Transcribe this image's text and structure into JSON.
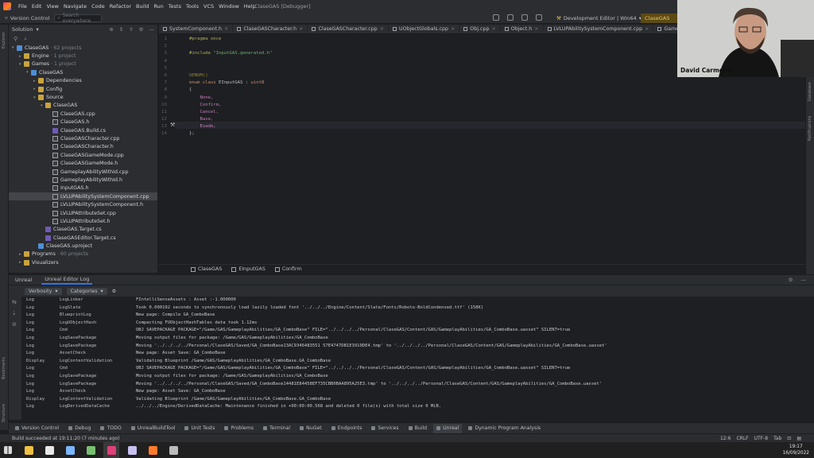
{
  "window": {
    "title": "ClaseGAS [Debugger]",
    "menu": [
      "File",
      "Edit",
      "View",
      "Navigate",
      "Code",
      "Refactor",
      "Build",
      "Run",
      "Tests",
      "Tools",
      "VCS",
      "Window",
      "Help"
    ]
  },
  "toolbar": {
    "version_control": "Version Control",
    "search_placeholder": "Search everywhere",
    "config": "Development Editor | Win64",
    "run_target": "ClaseGAS"
  },
  "explorer": {
    "mode": "Solution",
    "tree": [
      {
        "label": "ClaseGAS",
        "sub": "· 62 projects",
        "depth": 0,
        "arrow": "▾",
        "icon": "proj"
      },
      {
        "label": "Engine",
        "sub": "· 1 project",
        "depth": 1,
        "arrow": "▸",
        "icon": "folder"
      },
      {
        "label": "Games",
        "sub": "· 1 project",
        "depth": 1,
        "arrow": "▾",
        "icon": "folder"
      },
      {
        "label": "ClaseGAS",
        "sub": "",
        "depth": 2,
        "arrow": "▾",
        "icon": "proj"
      },
      {
        "label": "Dependencies",
        "sub": "",
        "depth": 3,
        "arrow": "▸",
        "icon": "folder"
      },
      {
        "label": "Config",
        "sub": "",
        "depth": 3,
        "arrow": "▸",
        "icon": "folder"
      },
      {
        "label": "Source",
        "sub": "",
        "depth": 3,
        "arrow": "▾",
        "icon": "folder"
      },
      {
        "label": "ClaseGAS",
        "sub": "",
        "depth": 4,
        "arrow": "▾",
        "icon": "folder"
      },
      {
        "label": "ClaseGAS.cpp",
        "sub": "",
        "depth": 5,
        "arrow": "",
        "icon": "file"
      },
      {
        "label": "ClaseGAS.h",
        "sub": "",
        "depth": 5,
        "arrow": "",
        "icon": "file"
      },
      {
        "label": "ClaseGAS.Build.cs",
        "sub": "",
        "depth": 5,
        "arrow": "",
        "icon": "cs"
      },
      {
        "label": "ClaseGASCharacter.cpp",
        "sub": "",
        "depth": 5,
        "arrow": "",
        "icon": "file"
      },
      {
        "label": "ClaseGASCharacter.h",
        "sub": "",
        "depth": 5,
        "arrow": "",
        "icon": "file"
      },
      {
        "label": "ClaseGASGameMode.cpp",
        "sub": "",
        "depth": 5,
        "arrow": "",
        "icon": "file"
      },
      {
        "label": "ClaseGASGameMode.h",
        "sub": "",
        "depth": 5,
        "arrow": "",
        "icon": "file"
      },
      {
        "label": "GameplayAbilityWithId.cpp",
        "sub": "",
        "depth": 5,
        "arrow": "",
        "icon": "file"
      },
      {
        "label": "GameplayAbilityWithId.h",
        "sub": "",
        "depth": 5,
        "arrow": "",
        "icon": "file"
      },
      {
        "label": "InputGAS.h",
        "sub": "",
        "depth": 5,
        "arrow": "",
        "icon": "file"
      },
      {
        "label": "LVLUPAbilitySystemComponent.cpp",
        "sub": "",
        "depth": 5,
        "arrow": "",
        "icon": "file",
        "selected": true
      },
      {
        "label": "LVLUPAbilitySystemComponent.h",
        "sub": "",
        "depth": 5,
        "arrow": "",
        "icon": "file"
      },
      {
        "label": "LVLUPAttributeSet.cpp",
        "sub": "",
        "depth": 5,
        "arrow": "",
        "icon": "file"
      },
      {
        "label": "LVLUPAttributeSet.h",
        "sub": "",
        "depth": 5,
        "arrow": "",
        "icon": "file"
      },
      {
        "label": "ClaseGAS.Target.cs",
        "sub": "",
        "depth": 4,
        "arrow": "",
        "icon": "cs"
      },
      {
        "label": "ClaseGASEditor.Target.cs",
        "sub": "",
        "depth": 4,
        "arrow": "",
        "icon": "cs"
      },
      {
        "label": "ClaseGAS.uproject",
        "sub": "",
        "depth": 3,
        "arrow": "",
        "icon": "proj"
      },
      {
        "label": "Programs",
        "sub": "· 60 projects",
        "depth": 1,
        "arrow": "▸",
        "icon": "folder"
      },
      {
        "label": "Visualizers",
        "sub": "",
        "depth": 1,
        "arrow": "▸",
        "icon": "folder"
      }
    ]
  },
  "editor_tabs": [
    "SystemComponent.h",
    "ClaseGASCharacter.h",
    "ClaseGASCharacter.cpp",
    "UObjectGlobals.cpp",
    "Obj.cpp",
    "Object.h",
    "LVLUPAbilitySystemComponent.cpp",
    "GameplayAbilityWithId.h"
  ],
  "code": {
    "line_numbers": [
      "1",
      "2",
      "3",
      "4",
      "5",
      "6",
      "7",
      "8",
      "9",
      "10",
      "11",
      "12",
      "13",
      "14"
    ],
    "lines": [
      [
        {
          "t": "#pragma once",
          "k": "pp"
        }
      ],
      [],
      [
        {
          "t": "#include ",
          "k": "pp"
        },
        {
          "t": "\"InputGAS.generated.h\"",
          "k": "str"
        }
      ],
      [],
      [],
      [
        {
          "t": "UENUM()",
          "k": "macro"
        }
      ],
      [
        {
          "t": "enum class ",
          "k": "kw"
        },
        {
          "t": "EInputGAS",
          "k": ""
        },
        {
          "t": " : ",
          "k": ""
        },
        {
          "t": "uint8",
          "k": "kw"
        }
      ],
      [
        {
          "t": "{",
          "k": ""
        }
      ],
      [
        {
          "t": "    None,",
          "k": "enumv"
        }
      ],
      [
        {
          "t": "    Confirm,",
          "k": "enumv"
        }
      ],
      [
        {
          "t": "    Cancel,",
          "k": "enumv"
        }
      ],
      [
        {
          "t": "    Base,",
          "k": "enumv"
        }
      ],
      [
        {
          "t": "    Evade,",
          "k": "enumv"
        }
      ],
      [
        {
          "t": "};",
          "k": ""
        }
      ]
    ]
  },
  "breadcrumbs": [
    "ClaseGAS",
    "EInputGAS",
    "Confirm"
  ],
  "panel": {
    "tabs": [
      "Unreal",
      "Unreal Editor Log"
    ],
    "verbosity": "Verbosity",
    "categories": "Categories"
  },
  "log": [
    {
      "v": "Log",
      "c": "LogLinker",
      "m": "FIntelliSenseAssets : Asset :-1.000000"
    },
    {
      "v": "Log",
      "c": "LogSlate",
      "m": "Took 0.000192 seconds to synchronously load lazily loaded font '../../../Engine/Content/Slate/Fonts/Roboto-BoldCondensed.ttf' (158K)"
    },
    {
      "v": "Log",
      "c": "BlueprintLog",
      "m": "New page: Compile GA_ComboBase"
    },
    {
      "v": "Log",
      "c": "LogUObjectHash",
      "m": "Compacting FUObjectHashTables data took   1.12ms"
    },
    {
      "v": "Log",
      "c": "Cmd",
      "m": "OBJ SAVEPACKAGE PACKAGE=\"/Game/GAS/GameplayAbilities/GA_ComboBase\" FILE=\"../../../../Personal/ClaseGAS/Content/GAS/GameplayAbilities/GA_ComboBase.uasset\" SILENT=true"
    },
    {
      "v": "Log",
      "c": "LogSavePackage",
      "m": "Moving output files for package: /Game/GAS/GameplayAbilities/GA_ComboBase"
    },
    {
      "v": "Log",
      "c": "LogSavePackage",
      "m": "Moving '../../../../Personal/ClaseGAS/Saved/GA_ComboBase13AC9346483551 57E4747DB1E3910DE4.tmp' to '../../../../Personal/ClaseGAS/Content/GAS/GameplayAbilities/GA_ComboBase.uasset'"
    },
    {
      "v": "Log",
      "c": "AssetCheck",
      "m": "New page: Asset Save: GA_ComboBase"
    },
    {
      "v": "Display",
      "c": "LogContentValidation",
      "m": "Validating Blueprint /Game/GAS/GameplayAbilities/GA_ComboBase.GA_ComboBase"
    },
    {
      "v": "Log",
      "c": "Cmd",
      "m": "OBJ SAVEPACKAGE PACKAGE=\"/Game/GAS/GameplayAbilities/GA_ComboBase\" FILE=\"../../../../Personal/ClaseGAS/Content/GAS/GameplayAbilities/GA_ComboBase.uasset\" SILENT=true"
    },
    {
      "v": "Log",
      "c": "LogSavePackage",
      "m": "Moving output files for package: /Game/GAS/GameplayAbilities/GA_ComboBase"
    },
    {
      "v": "Log",
      "c": "LogSavePackage",
      "m": "Moving '../../../../Personal/ClaseGAS/Saved/GA_ComboBase14481E84458EF735CBB0BAA895A25E3.tmp' to '../../../../Personal/ClaseGAS/Content/GAS/GameplayAbilities/GA_ComboBase.uasset'"
    },
    {
      "v": "Log",
      "c": "AssetCheck",
      "m": "New page: Asset Save: GA_ComboBase"
    },
    {
      "v": "Display",
      "c": "LogContentValidation",
      "m": "Validating Blueprint /Game/GAS/GameplayAbilities/GA_ComboBase.GA_ComboBase"
    },
    {
      "v": "Log",
      "c": "LogDerivedDataCache",
      "m": "../../../Engine/DerivedDataCache: Maintenance finished in +00:00:00.568 and deleted 0 file(s) with total size 0 MiB."
    }
  ],
  "tool_windows": [
    "Version Control",
    "Debug",
    "TODO",
    "UnrealBuildTool",
    "Unit Tests",
    "Problems",
    "Terminal",
    "NuGet",
    "Endpoints",
    "Services",
    "Build",
    "Unreal",
    "Dynamic Program Analysis"
  ],
  "status": {
    "message": "Build succeeded at 19:11:20 (7 minutes ago)",
    "position": "12:6",
    "line_sep": "CRLF",
    "encoding": "UTF-8",
    "indent": "Tab"
  },
  "side_labels": {
    "left": [
      "Explorer",
      "Bookmarks",
      "Structure"
    ],
    "right": [
      "Database",
      "Notifications"
    ]
  },
  "webcam": {
    "name": "David Carmona"
  },
  "clock": {
    "time": "19:17",
    "date": "16/09/2022"
  },
  "taskbar_apps": [
    {
      "name": "file-explorer",
      "color": "#f0c040"
    },
    {
      "name": "unreal-engine",
      "color": "#e8e8e8"
    },
    {
      "name": "unreal-engine-2",
      "color": "#7ab6ff"
    },
    {
      "name": "notepad",
      "color": "#77c070"
    },
    {
      "name": "rider",
      "color": "#e0407a"
    },
    {
      "name": "terminal",
      "color": "#c8c0f0"
    },
    {
      "name": "firefox",
      "color": "#ff7b2b"
    },
    {
      "name": "obs",
      "color": "#bbbbbb"
    }
  ],
  "colors": {
    "accent": "#3574f0",
    "run_config": "#5c4a14",
    "selection": "#43454a"
  }
}
